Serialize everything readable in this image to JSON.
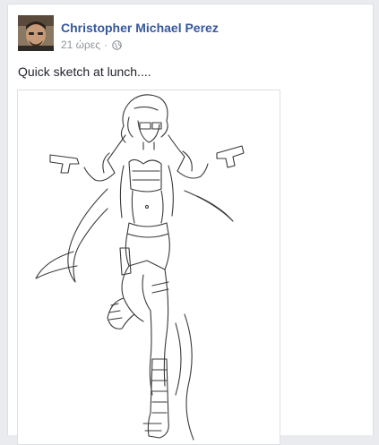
{
  "post": {
    "author": "Christopher Michael Perez",
    "timestamp": "21 ώρες",
    "separator": "·",
    "privacy_icon": "globe-icon",
    "text": "Quick sketch at lunch....",
    "image_icon": "sketch-drawing"
  },
  "colors": {
    "author_link": "#365899",
    "meta_text": "#90949c",
    "body_text": "#1d2129",
    "background": "#e9ebee"
  }
}
